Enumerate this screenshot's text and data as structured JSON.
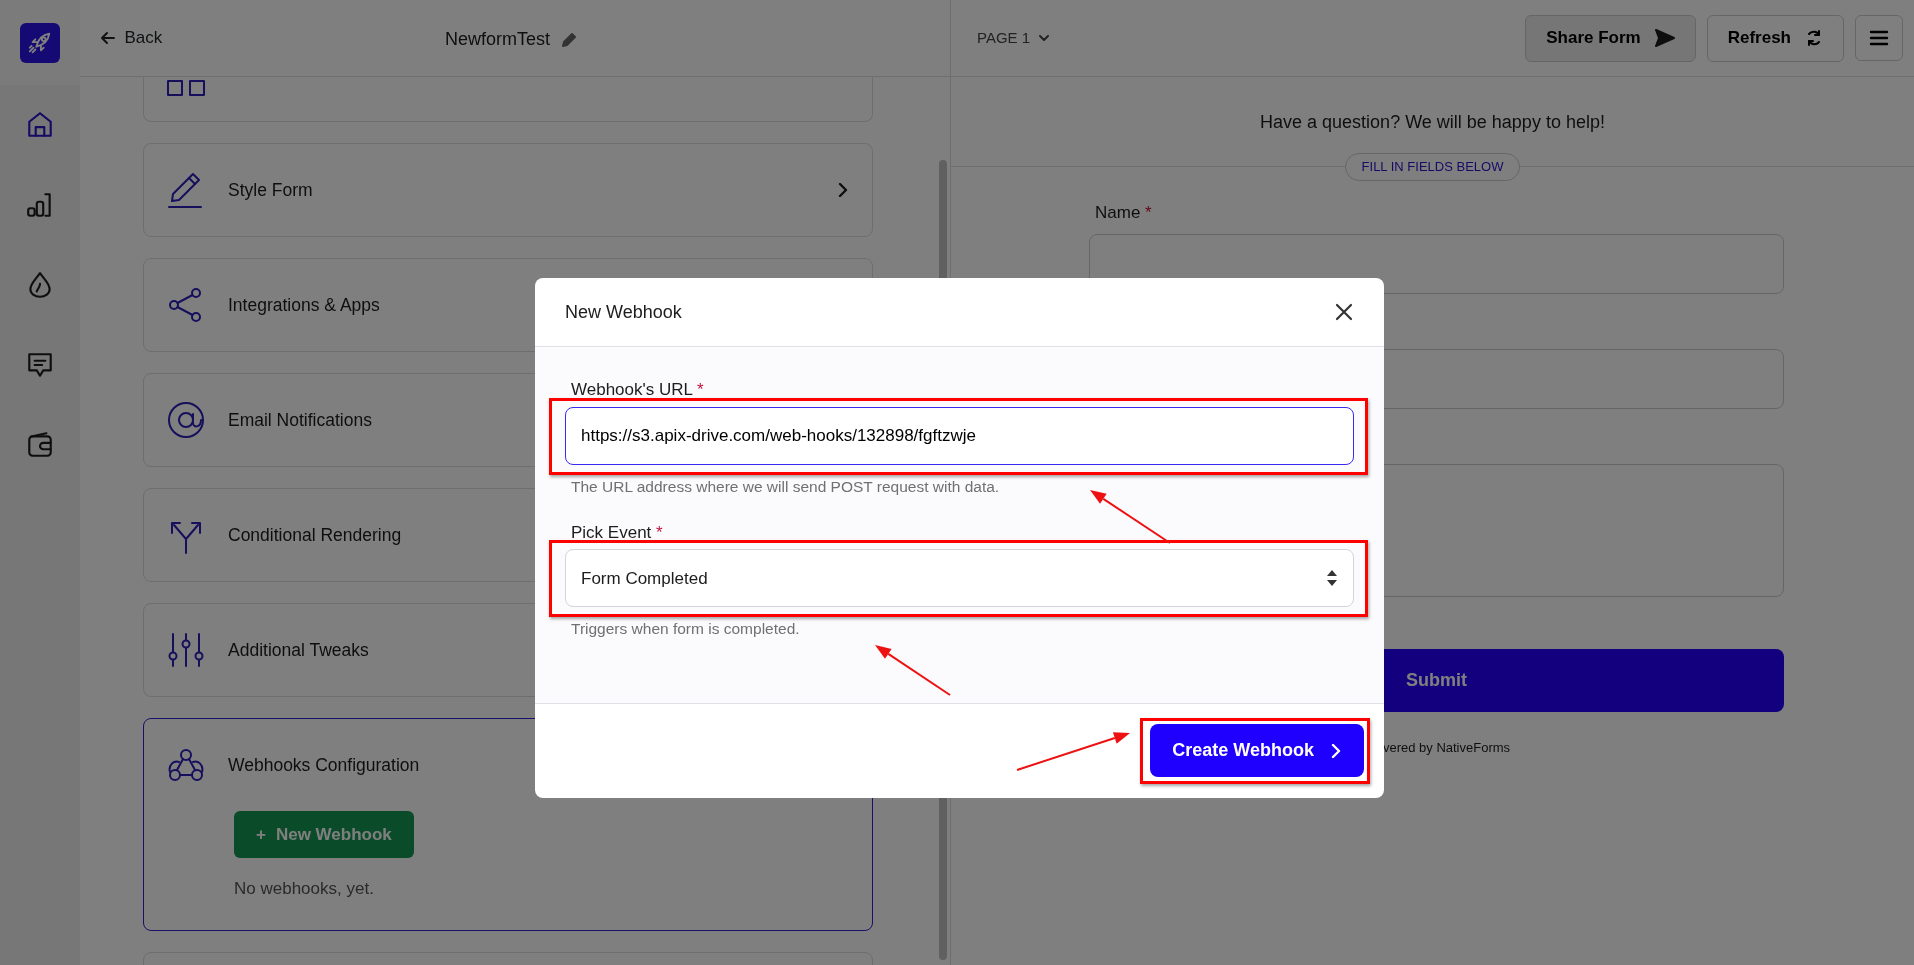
{
  "rail_items": [
    {
      "kind": "logo"
    },
    {
      "kind": "home",
      "selected": true
    },
    {
      "kind": "stats",
      "selected": false
    },
    {
      "kind": "drop",
      "selected": false
    },
    {
      "kind": "chat",
      "selected": false
    },
    {
      "kind": "wallet",
      "selected": false
    }
  ],
  "editor": {
    "back": "Back",
    "title": "NewformTest",
    "sections": [
      {
        "kind": "questions",
        "expanded": false
      },
      {
        "kind": "style",
        "label": "Style Form",
        "expanded": false
      },
      {
        "kind": "share",
        "label": "Integrations & Apps",
        "expanded": false
      },
      {
        "kind": "email",
        "label": "Email Notifications",
        "expanded": false
      },
      {
        "kind": "branch",
        "label": "Conditional Rendering",
        "expanded": false
      },
      {
        "kind": "sliders",
        "label": "Additional Tweaks",
        "expanded": false
      },
      {
        "kind": "webhook",
        "label": "Webhooks Configuration",
        "expanded": true,
        "button": "New Webhook",
        "button_icon": "+",
        "empty_text": "No webhooks, yet."
      },
      {
        "kind": "blank"
      }
    ]
  },
  "preview": {
    "page": "PAGE 1",
    "share": "Share Form",
    "refresh": "Refresh",
    "intro": "Have a question? We will be happy to help!",
    "divider": "FILL IN FIELDS BELOW",
    "fields": [
      {
        "kind": "input",
        "label": "Name",
        "required": "*"
      },
      {
        "kind": "input"
      },
      {
        "kind": "textarea"
      }
    ],
    "submit": "Submit",
    "powered": "vered by",
    "brand": "NativeForms"
  },
  "modal": {
    "title": "New Webhook",
    "fields": [
      {
        "kind": "input",
        "label": "Webhook's URL",
        "required": "*",
        "value": "https://s3.apix-drive.com/web-hooks/132898/fgftzwje",
        "help": "The URL address where we will send POST request with data.",
        "focused": true,
        "highlighted": true
      },
      {
        "kind": "select",
        "label": "Pick Event",
        "required": "*",
        "value": "Form Completed",
        "help": "Triggers when form is completed.",
        "focused": false,
        "highlighted": true
      }
    ],
    "submit": {
      "label": "Create Webhook",
      "highlighted": true
    }
  }
}
